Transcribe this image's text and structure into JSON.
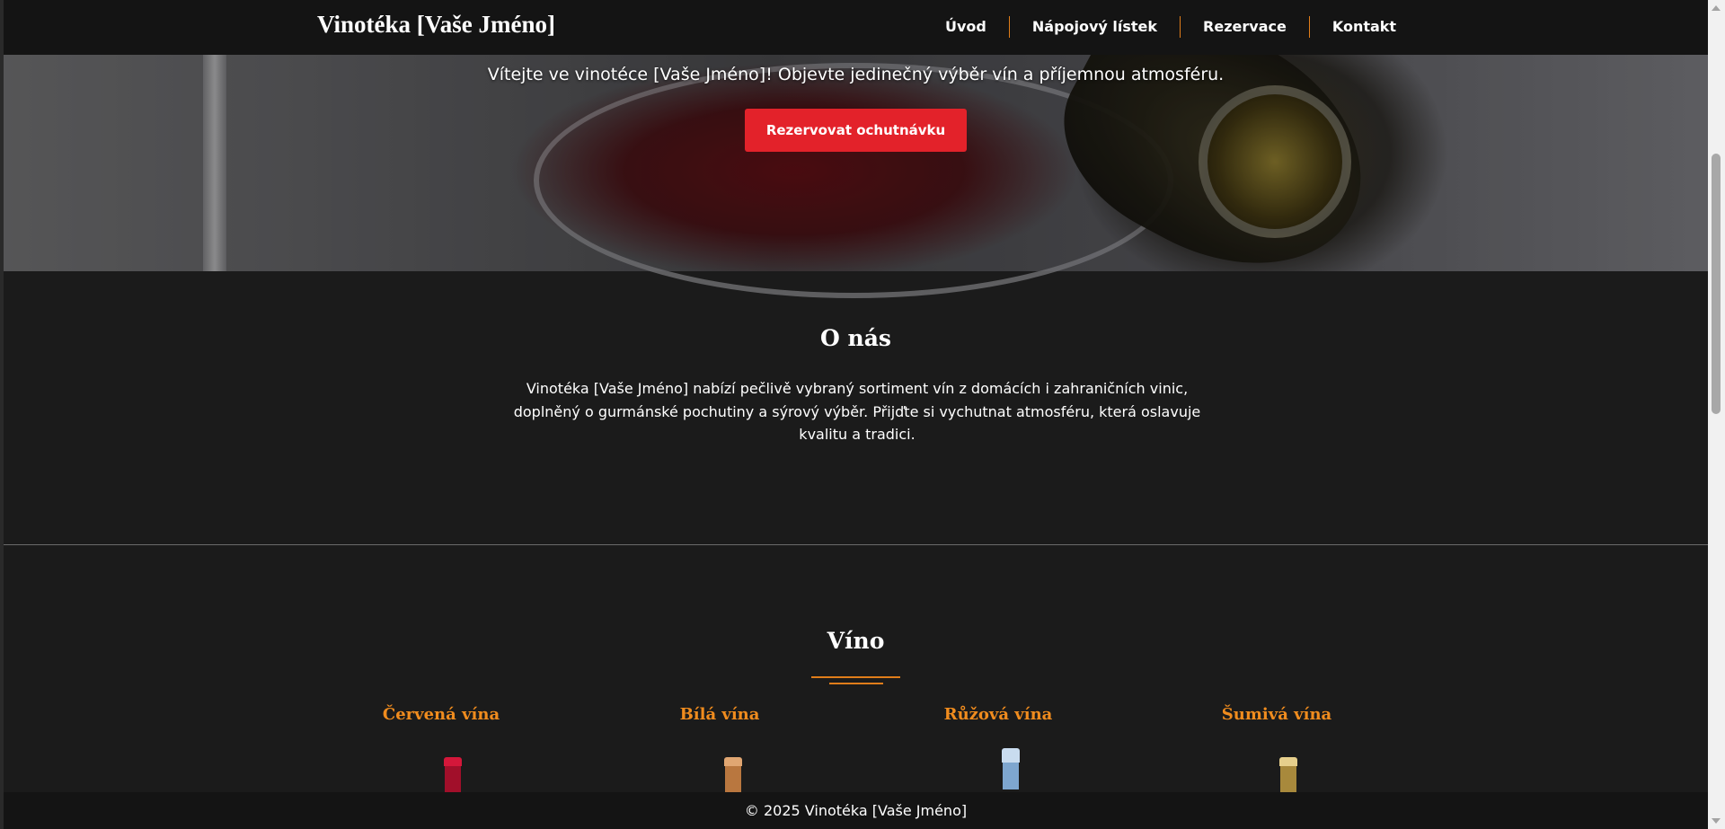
{
  "header": {
    "brand": "Vinotéka [Vaše Jméno]",
    "nav": [
      {
        "label": "Úvod"
      },
      {
        "label": "Nápojový lístek"
      },
      {
        "label": "Rezervace"
      },
      {
        "label": "Kontakt"
      }
    ]
  },
  "hero": {
    "tagline": "Vítejte ve vinotéce [Vaše Jméno]! Objevte jedinečný výběr vín a příjemnou atmosféru.",
    "cta_label": "Rezervovat ochutnávku"
  },
  "about": {
    "title": "O nás",
    "text": "Vinotéka [Vaše Jméno] nabízí pečlivě vybraný sortiment vín z domácích i zahraničních vinic, doplněný o gurmánské pochutiny a sýrový výběr. Přijďte si vychutnat atmosféru, která oslavuje kvalitu a tradici."
  },
  "wines": {
    "title": "Víno",
    "categories": [
      {
        "label": "Červená vína",
        "icon": "red-wine-bottle-icon",
        "color": "#b3122c"
      },
      {
        "label": "Bílá vína",
        "icon": "white-wine-bottle-icon",
        "color": "#c98a4a"
      },
      {
        "label": "Růžová vína",
        "icon": "rose-wine-bottle-icon",
        "color": "#8fb3d6"
      },
      {
        "label": "Šumivá vína",
        "icon": "sparkling-wine-bottle-icon",
        "color": "#c9a85a"
      }
    ]
  },
  "footer": {
    "copyright": "© 2025 Vinotéka [Vaše Jméno]"
  },
  "colors": {
    "accent": "#e07d1a",
    "cta": "#e3222a",
    "background": "#1b1b1b"
  }
}
